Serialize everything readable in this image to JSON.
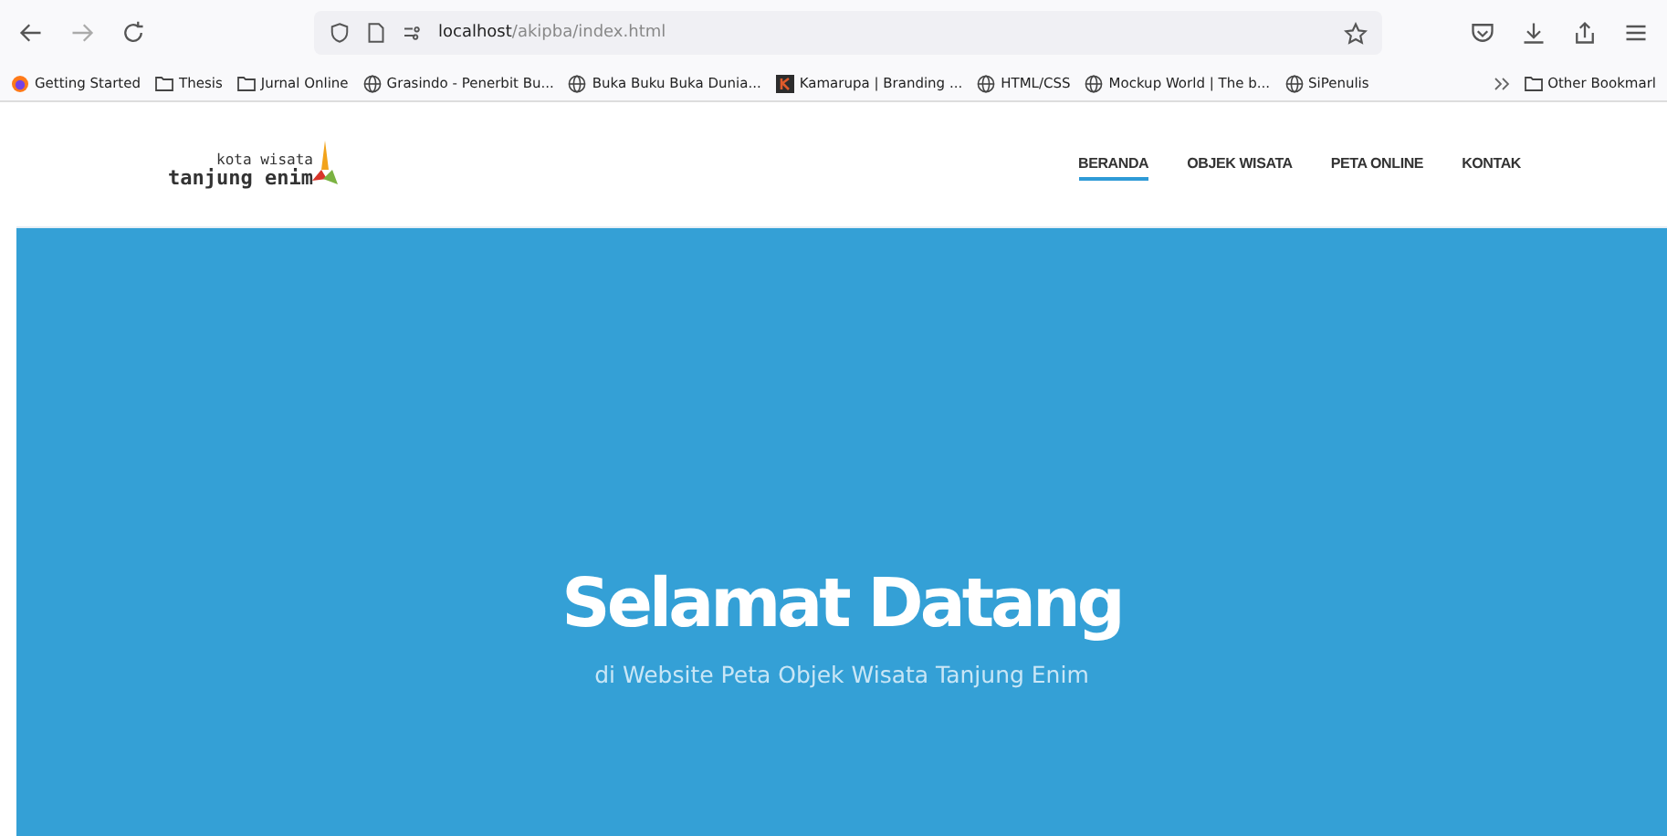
{
  "browser": {
    "url_host": "localhost",
    "url_path": "/akipba/index.html"
  },
  "bookmarks": [
    {
      "kind": "firefox",
      "label": "Getting Started"
    },
    {
      "kind": "folder",
      "label": "Thesis"
    },
    {
      "kind": "folder",
      "label": "Jurnal Online"
    },
    {
      "kind": "globe",
      "label": "Grasindo - Penerbit Bu..."
    },
    {
      "kind": "globe",
      "label": "Buka Buku Buka Dunia..."
    },
    {
      "kind": "brand",
      "label": "Kamarupa | Branding ..."
    },
    {
      "kind": "globe",
      "label": "HTML/CSS"
    },
    {
      "kind": "globe",
      "label": "Mockup World | The b..."
    },
    {
      "kind": "globe",
      "label": "SiPenulis"
    }
  ],
  "other_bookmarks": "Other Bookmarl",
  "logo": {
    "small": "kota wisata",
    "big": "tanjung enim"
  },
  "nav": [
    {
      "label": "BERANDA",
      "selected": true
    },
    {
      "label": "OBJEK WISATA",
      "selected": false
    },
    {
      "label": "PETA ONLINE",
      "selected": false
    },
    {
      "label": "KONTAK",
      "selected": false
    }
  ],
  "hero": {
    "title": "Selamat Datang",
    "subtitle": "di Website Peta Objek Wisata Tanjung Enim"
  }
}
